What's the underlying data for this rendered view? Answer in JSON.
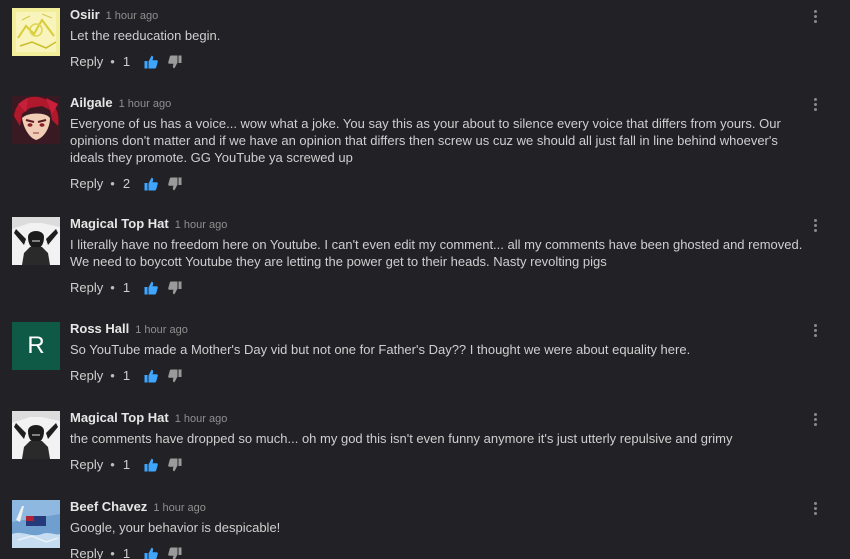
{
  "colors": {
    "background": "#222226",
    "like_active": "#3ea6ff",
    "dislike": "#9a9a9a",
    "avatar_letter_bg": "#0e5a47"
  },
  "labels": {
    "reply": "Reply",
    "separator": "•"
  },
  "icons": {
    "like": "thumbs-up-icon",
    "dislike": "thumbs-down-icon",
    "menu": "more-vertical-icon"
  },
  "comments": [
    {
      "author": "Osiir",
      "time": "1 hour ago",
      "text": "Let the reeducation begin.",
      "likes": "1",
      "avatar": "yellow-sketch"
    },
    {
      "author": "Ailgale",
      "time": "1 hour ago",
      "text": "Everyone of us has a voice... wow what a joke. You say this as your about to silence every voice that differs from yours. Our opinions don't matter and if we have an opinion that differs then screw us cuz we should all just fall in line behind whoever's ideals they promote. GG YouTube ya screwed up",
      "likes": "2",
      "avatar": "red-hair-anime"
    },
    {
      "author": "Magical Top Hat",
      "time": "1 hour ago",
      "text": "I literally have no freedom here on Youtube. I can't even edit my comment... all my comments have been ghosted and removed. We need to boycott Youtube they are letting the power get to their heads. Nasty revolting pigs",
      "likes": "1",
      "avatar": "monochrome-figure"
    },
    {
      "author": "Ross Hall",
      "time": "1 hour ago",
      "text": "So YouTube made a Mother's Day vid but not one for Father's Day?? I thought we were about equality here.",
      "likes": "1",
      "avatar": "letter",
      "avatar_letter": "R"
    },
    {
      "author": "Magical Top Hat",
      "time": "1 hour ago",
      "text": "the comments have dropped so much... oh my god this isn't even funny anymore it's just utterly repulsive and grimy",
      "likes": "1",
      "avatar": "monochrome-figure"
    },
    {
      "author": "Beef Chavez",
      "time": "1 hour ago",
      "text": "Google, your behavior is despicable!",
      "likes": "1",
      "avatar": "sky-flag"
    }
  ]
}
